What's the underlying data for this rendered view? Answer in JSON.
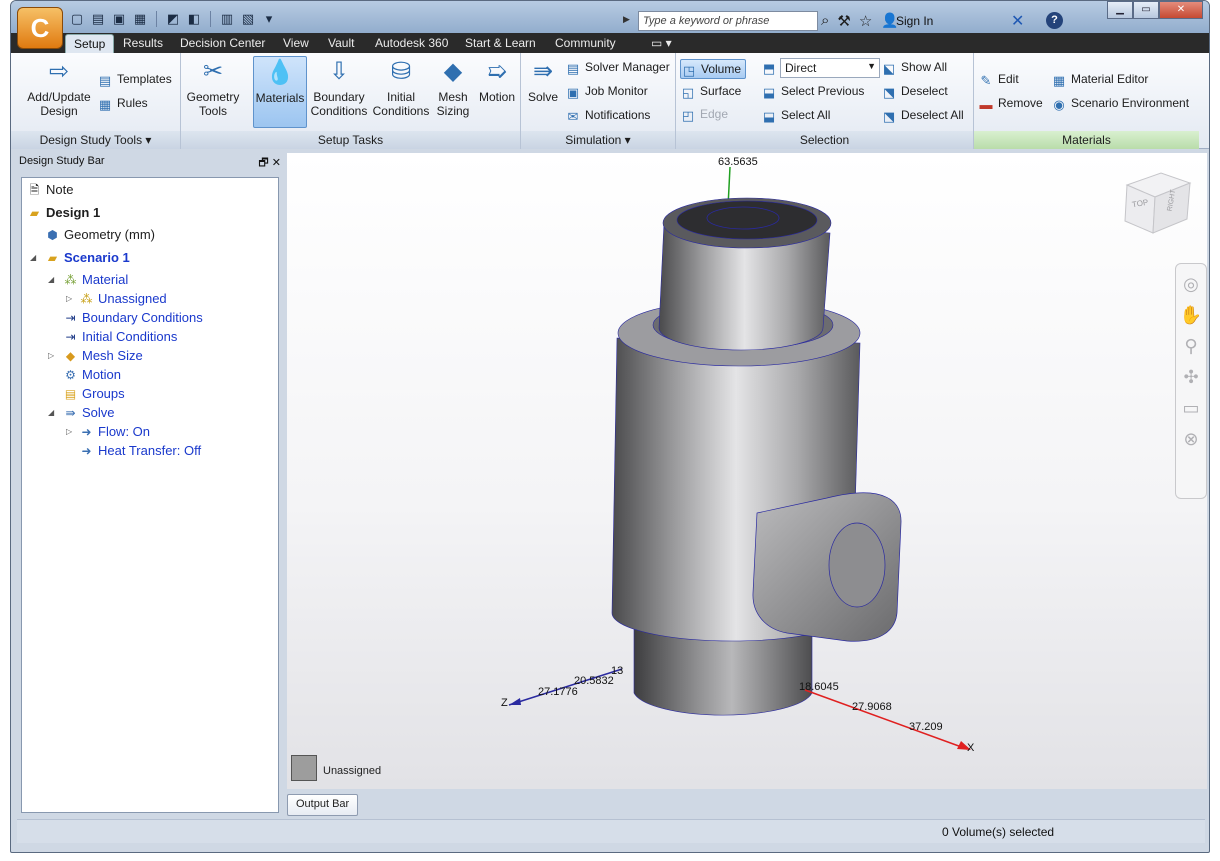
{
  "titlebar": {
    "app_logo": "C",
    "search_placeholder": "Type a keyword or phrase",
    "sign_in": "Sign In",
    "help": "?"
  },
  "tabs": [
    "Setup",
    "Results",
    "Decision Center",
    "View",
    "Vault",
    "Autodesk 360",
    "Start & Learn",
    "Community"
  ],
  "ribbon": {
    "design_study_tools": {
      "label": "Design Study Tools",
      "add_update": "Add/Update\nDesign",
      "add_update_line1": "Add/Update",
      "add_update_line2": "Design",
      "templates": "Templates",
      "rules": "Rules"
    },
    "setup_tasks": {
      "label": "Setup Tasks",
      "geometry_tools_1": "Geometry",
      "geometry_tools_2": "Tools",
      "materials": "Materials",
      "boundary_1": "Boundary",
      "boundary_2": "Conditions",
      "initial_1": "Initial",
      "initial_2": "Conditions",
      "mesh_1": "Mesh",
      "mesh_2": "Sizing",
      "motion": "Motion"
    },
    "simulation": {
      "label": "Simulation",
      "solve": "Solve",
      "solver_manager": "Solver Manager",
      "job_monitor": "Job Monitor",
      "notifications": "Notifications"
    },
    "selection": {
      "label": "Selection",
      "volume": "Volume",
      "surface": "Surface",
      "edge": "Edge",
      "mode": "Direct",
      "select_previous": "Select Previous",
      "select_all": "Select All",
      "show_all": "Show All",
      "deselect": "Deselect",
      "deselect_all": "Deselect All"
    },
    "materials": {
      "label": "Materials",
      "edit": "Edit",
      "remove": "Remove",
      "material_editor": "Material Editor",
      "scenario_environment": "Scenario Environment"
    }
  },
  "design_study_bar": {
    "title": "Design Study Bar",
    "nodes": {
      "note": "Note",
      "design": "Design 1",
      "geometry": "Geometry (mm)",
      "scenario": "Scenario 1",
      "material": "Material",
      "unassigned": "Unassigned",
      "boundary": "Boundary Conditions",
      "initial": "Initial Conditions",
      "mesh": "Mesh Size",
      "motion": "Motion",
      "groups": "Groups",
      "solve": "Solve",
      "flow": "Flow: On",
      "heat": "Heat Transfer: Off"
    }
  },
  "viewport": {
    "legend_label": "Unassigned",
    "viewcube_top": "TOP",
    "viewcube_right": "RIGHT",
    "axis_labels": {
      "y_top": "63.5635",
      "z_1": "13",
      "z_2": "20.5832",
      "z_3": "27.1776",
      "z_name": "Z",
      "x_1": "18.6045",
      "x_2": "27.9068",
      "x_3": "37.209",
      "x_name": "X"
    }
  },
  "output_bar": "Output Bar",
  "status": "0 Volume(s) selected"
}
